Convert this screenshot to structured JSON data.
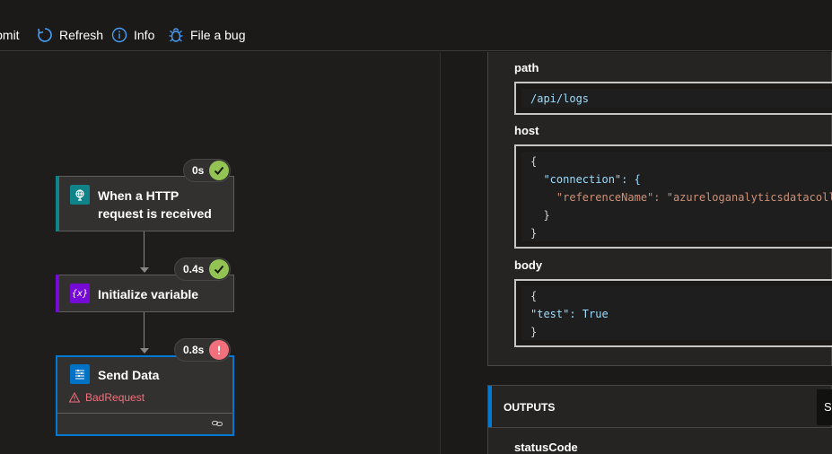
{
  "toolbar": {
    "submit_label": "Submit",
    "refresh_label": "Refresh",
    "info_label": "Info",
    "bug_label": "File a bug",
    "icon_color": "#479ef5"
  },
  "flow": {
    "steps": [
      {
        "title": "When a HTTP request is received",
        "duration": "0s",
        "status": "succeeded",
        "icon": "http-trigger-icon",
        "color": "#0f8387"
      },
      {
        "title": "Initialize variable",
        "duration": "0.4s",
        "status": "succeeded",
        "icon": "variable-icon",
        "color": "#770bd6"
      },
      {
        "title": "Send Data",
        "duration": "0.8s",
        "status": "failed",
        "icon": "azure-log-analytics-icon",
        "color": "#0072c6",
        "error": "BadRequest"
      }
    ],
    "success_color": "#92c353",
    "error_color": "#f1707b"
  },
  "details": {
    "path": {
      "label": "path",
      "value": "/api/logs"
    },
    "host": {
      "label": "host",
      "lines": [
        "{",
        "  \"connection\": {",
        "    \"referenceName\": \"azureloganalyticsdatacoll",
        "  }",
        "}"
      ]
    },
    "body": {
      "label": "body",
      "lines": [
        "{",
        "\"test\": True",
        "}"
      ]
    },
    "outputs": {
      "title": "OUTPUTS",
      "button_label": "Show raw outputs",
      "first_field": "statusCode"
    }
  }
}
